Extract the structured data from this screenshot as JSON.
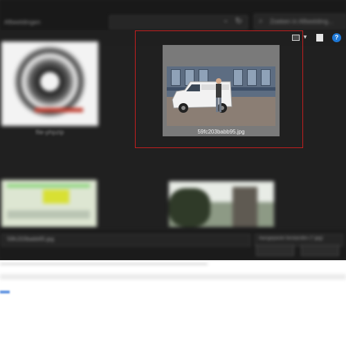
{
  "window": {
    "title": "Afbeeldingen"
  },
  "search": {
    "placeholder": "Zoeken in Afbeelding..."
  },
  "items": [
    {
      "label": "file-phpzip"
    },
    {
      "label": "59fc203babb95.jpg",
      "selected": true
    },
    {
      "label": ""
    },
    {
      "label": ""
    }
  ],
  "bottom_bar": {
    "filename_label": "59fc203babb95.jpg",
    "filetype_label": "Aangepaste bestanden (*.jpg)"
  },
  "colors": {
    "selection_border": "#c81e1e",
    "help_icon": "#1e78d6"
  },
  "icons": {
    "view": "view-options-icon",
    "pane": "preview-pane-icon",
    "help": "help-icon",
    "search": "search-icon",
    "refresh": "refresh-icon"
  }
}
